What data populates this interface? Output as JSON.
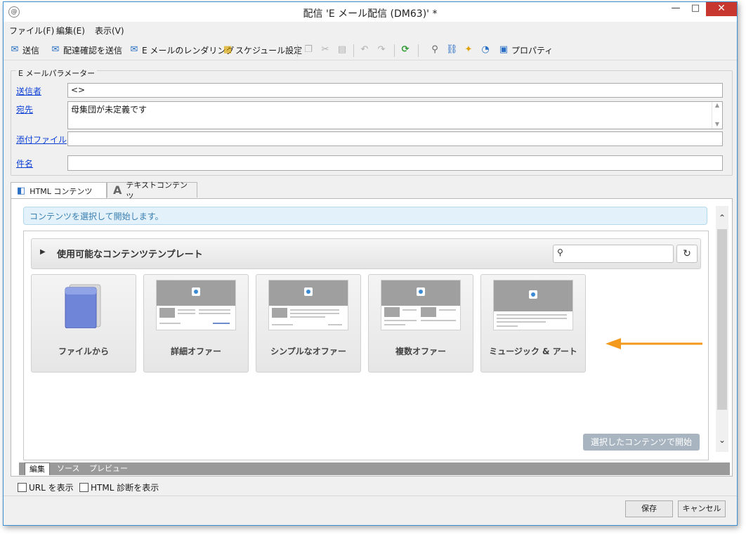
{
  "window": {
    "title": "配信 'E メール配信 (DM63)' *",
    "minimize_symbol": "—",
    "maximize_symbol": "□",
    "close_symbol": "✕"
  },
  "menu": [
    "ファイル(F)",
    "編集(E)",
    "表示(V)"
  ],
  "toolbar": {
    "send": "送信",
    "send_proof": "配達確認を送信",
    "render_email": "E メールのレンダリング",
    "schedule": "スケジュール設定",
    "properties": "プロパティ"
  },
  "email_params": {
    "legend": "E メールパラメーター",
    "sender_label": "送信者",
    "sender_value": "<>",
    "to_label": "宛先",
    "to_value": "母集団が未定義です",
    "attachment_label": "添付ファイル",
    "attachment_value": "",
    "subject_label": "件名",
    "subject_value": ""
  },
  "tabs": {
    "html": "HTML コンテンツ",
    "text": "テキストコンテンツ"
  },
  "content_panel": {
    "notice": "コンテンツを選択して開始します。",
    "templates_title": "使用可能なコンテンツテンプレート",
    "search_value": "",
    "templates": [
      {
        "label": "ファイルから",
        "kind": "folder"
      },
      {
        "label": "詳細オファー",
        "kind": "detailed"
      },
      {
        "label": "シンプルなオファー",
        "kind": "simple"
      },
      {
        "label": "複数オファー",
        "kind": "multiple"
      },
      {
        "label": "ミュージック & アート",
        "kind": "music"
      }
    ],
    "start_button": "選択したコンテンツで開始"
  },
  "bottom_tabs": [
    "編集",
    "ソース",
    "プレビュー"
  ],
  "checkboxes": {
    "show_url": "URL を表示",
    "show_html_diag": "HTML 診断を表示"
  },
  "buttons": {
    "save": "保存",
    "cancel": "キャンセル"
  },
  "colors": {
    "accent_arrow": "#f39a1e",
    "notice_bg": "#e2f1fa",
    "close_button": "#c7372f",
    "link": "#0b3fd6"
  }
}
